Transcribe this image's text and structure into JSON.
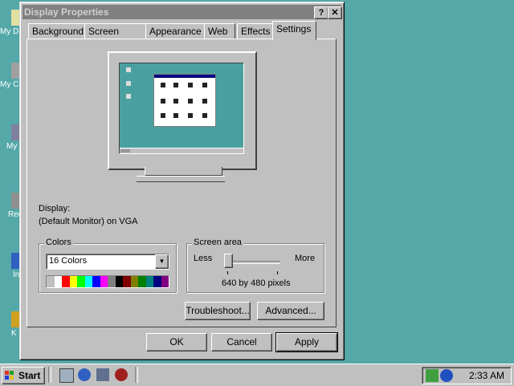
{
  "desktop": {
    "icons": [
      {
        "label": "My D",
        "icon": "my-documents-icon"
      },
      {
        "label": "My C",
        "icon": "my-computer-icon"
      },
      {
        "label": "My",
        "icon": "network-icon"
      },
      {
        "label": "Rec",
        "icon": "recycle-bin-icon"
      },
      {
        "label": "In",
        "icon": "internet-explorer-icon"
      },
      {
        "label": "K",
        "icon": "kodak-icon"
      }
    ]
  },
  "window": {
    "title": "Display Properties",
    "help_btn": "?",
    "close_btn": "✕",
    "tabs": [
      "Background",
      "Screen Saver",
      "Appearance",
      "Web",
      "Effects",
      "Settings"
    ],
    "active_tab": "Settings",
    "display_label": "Display:",
    "display_value": "(Default Monitor) on VGA",
    "colors_group": "Colors",
    "colors_selected": "16 Colors",
    "palette": [
      "#c0c0c0",
      "#ffffff",
      "#ff0000",
      "#ffff00",
      "#00ff00",
      "#00ffff",
      "#0000ff",
      "#ff00ff",
      "#808080",
      "#000000",
      "#800000",
      "#808000",
      "#008000",
      "#008080",
      "#000080",
      "#800080"
    ],
    "screen_area_group": "Screen area",
    "slider_less": "Less",
    "slider_more": "More",
    "slider_level": 0,
    "resolution": "640 by 480 pixels",
    "troubleshoot_btn": "Troubleshoot...",
    "advanced_btn": "Advanced...",
    "ok_btn": "OK",
    "cancel_btn": "Cancel",
    "apply_btn": "Apply"
  },
  "taskbar": {
    "start_label": "Start",
    "clock": "2:33 AM"
  }
}
